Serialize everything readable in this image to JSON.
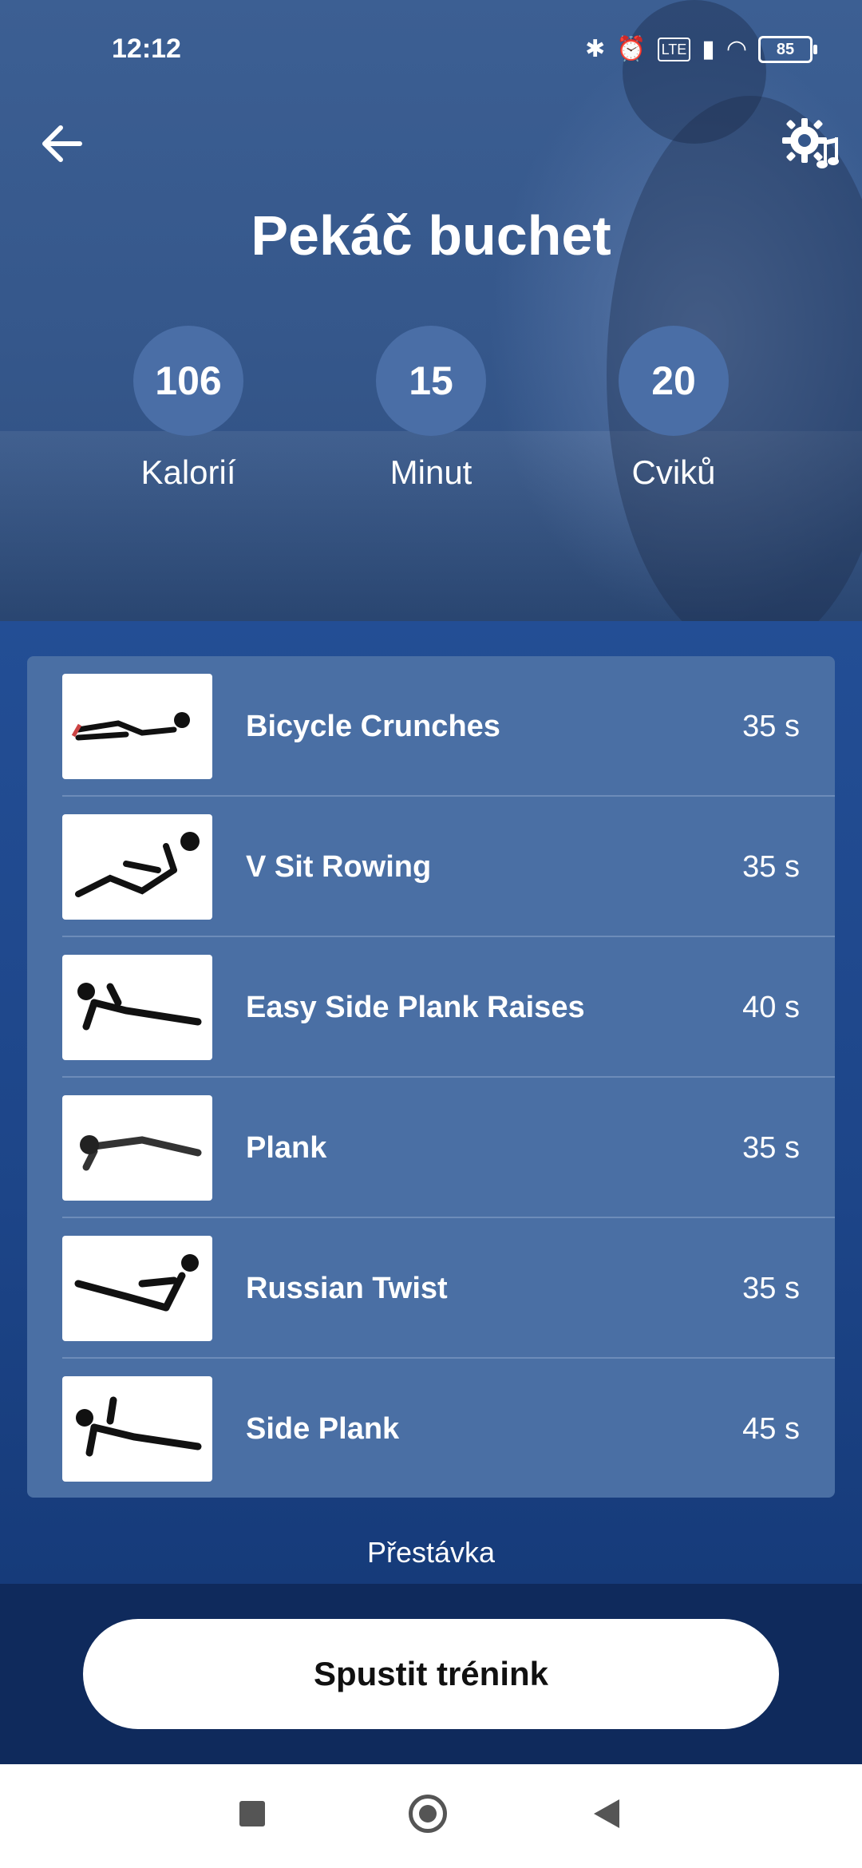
{
  "status_bar": {
    "time": "12:12",
    "battery": "85",
    "icons": [
      "bluetooth-icon",
      "alarm-icon",
      "volte-icon",
      "signal-icon",
      "wifi-icon",
      "battery-icon"
    ]
  },
  "header": {
    "title": "Pekáč buchet",
    "back_icon": "back-arrow-icon",
    "settings_icon": "gear-music-icon"
  },
  "stats": [
    {
      "value": "106",
      "label": "Kalorií"
    },
    {
      "value": "15",
      "label": "Minut"
    },
    {
      "value": "20",
      "label": "Cviků"
    }
  ],
  "exercises": [
    {
      "name": "Bicycle Crunches",
      "duration": "35 s"
    },
    {
      "name": "V Sit Rowing",
      "duration": "35 s"
    },
    {
      "name": "Easy Side Plank Raises",
      "duration": "40 s"
    },
    {
      "name": "Plank",
      "duration": "35 s"
    },
    {
      "name": "Russian Twist",
      "duration": "35 s"
    },
    {
      "name": "Side Plank",
      "duration": "45 s"
    }
  ],
  "pause_label": "Přestávka",
  "start_button": "Spustit trénink",
  "colors": {
    "hero": "#35578b",
    "list_bg": "#4a6fa4",
    "stat_circle": "#4a6ea6",
    "footer": "#0f2a5c"
  }
}
